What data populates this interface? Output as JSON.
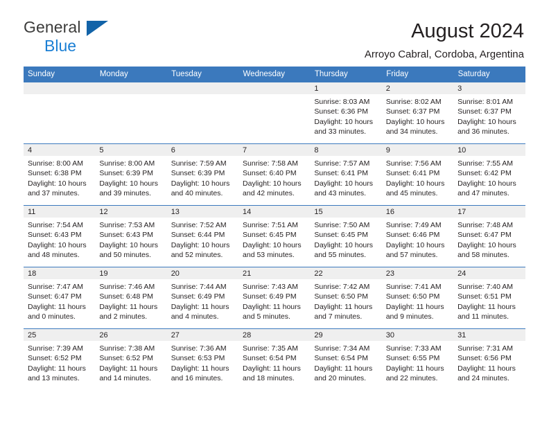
{
  "brand": {
    "line1": "General",
    "line2": "Blue",
    "logo_icon": "triangle-logo-icon"
  },
  "header": {
    "title": "August 2024",
    "subtitle": "Arroyo Cabral, Cordoba, Argentina"
  },
  "colors": {
    "header_blue": "#3b79bd",
    "brand_blue": "#1b7fd4",
    "logo_blue": "#1263a8",
    "band_gray": "#efefef",
    "text": "#231f20"
  },
  "weekdays": [
    "Sunday",
    "Monday",
    "Tuesday",
    "Wednesday",
    "Thursday",
    "Friday",
    "Saturday"
  ],
  "labels": {
    "sunrise": "Sunrise:",
    "sunset": "Sunset:",
    "daylight": "Daylight:"
  },
  "weeks": [
    [
      {
        "day": "",
        "empty": true
      },
      {
        "day": "",
        "empty": true
      },
      {
        "day": "",
        "empty": true
      },
      {
        "day": "",
        "empty": true
      },
      {
        "day": "1",
        "sunrise": "Sunrise: 8:03 AM",
        "sunset": "Sunset: 6:36 PM",
        "daylight_1": "Daylight: 10 hours",
        "daylight_2": "and 33 minutes."
      },
      {
        "day": "2",
        "sunrise": "Sunrise: 8:02 AM",
        "sunset": "Sunset: 6:37 PM",
        "daylight_1": "Daylight: 10 hours",
        "daylight_2": "and 34 minutes."
      },
      {
        "day": "3",
        "sunrise": "Sunrise: 8:01 AM",
        "sunset": "Sunset: 6:37 PM",
        "daylight_1": "Daylight: 10 hours",
        "daylight_2": "and 36 minutes."
      }
    ],
    [
      {
        "day": "4",
        "sunrise": "Sunrise: 8:00 AM",
        "sunset": "Sunset: 6:38 PM",
        "daylight_1": "Daylight: 10 hours",
        "daylight_2": "and 37 minutes."
      },
      {
        "day": "5",
        "sunrise": "Sunrise: 8:00 AM",
        "sunset": "Sunset: 6:39 PM",
        "daylight_1": "Daylight: 10 hours",
        "daylight_2": "and 39 minutes."
      },
      {
        "day": "6",
        "sunrise": "Sunrise: 7:59 AM",
        "sunset": "Sunset: 6:39 PM",
        "daylight_1": "Daylight: 10 hours",
        "daylight_2": "and 40 minutes."
      },
      {
        "day": "7",
        "sunrise": "Sunrise: 7:58 AM",
        "sunset": "Sunset: 6:40 PM",
        "daylight_1": "Daylight: 10 hours",
        "daylight_2": "and 42 minutes."
      },
      {
        "day": "8",
        "sunrise": "Sunrise: 7:57 AM",
        "sunset": "Sunset: 6:41 PM",
        "daylight_1": "Daylight: 10 hours",
        "daylight_2": "and 43 minutes."
      },
      {
        "day": "9",
        "sunrise": "Sunrise: 7:56 AM",
        "sunset": "Sunset: 6:41 PM",
        "daylight_1": "Daylight: 10 hours",
        "daylight_2": "and 45 minutes."
      },
      {
        "day": "10",
        "sunrise": "Sunrise: 7:55 AM",
        "sunset": "Sunset: 6:42 PM",
        "daylight_1": "Daylight: 10 hours",
        "daylight_2": "and 47 minutes."
      }
    ],
    [
      {
        "day": "11",
        "sunrise": "Sunrise: 7:54 AM",
        "sunset": "Sunset: 6:43 PM",
        "daylight_1": "Daylight: 10 hours",
        "daylight_2": "and 48 minutes."
      },
      {
        "day": "12",
        "sunrise": "Sunrise: 7:53 AM",
        "sunset": "Sunset: 6:43 PM",
        "daylight_1": "Daylight: 10 hours",
        "daylight_2": "and 50 minutes."
      },
      {
        "day": "13",
        "sunrise": "Sunrise: 7:52 AM",
        "sunset": "Sunset: 6:44 PM",
        "daylight_1": "Daylight: 10 hours",
        "daylight_2": "and 52 minutes."
      },
      {
        "day": "14",
        "sunrise": "Sunrise: 7:51 AM",
        "sunset": "Sunset: 6:45 PM",
        "daylight_1": "Daylight: 10 hours",
        "daylight_2": "and 53 minutes."
      },
      {
        "day": "15",
        "sunrise": "Sunrise: 7:50 AM",
        "sunset": "Sunset: 6:45 PM",
        "daylight_1": "Daylight: 10 hours",
        "daylight_2": "and 55 minutes."
      },
      {
        "day": "16",
        "sunrise": "Sunrise: 7:49 AM",
        "sunset": "Sunset: 6:46 PM",
        "daylight_1": "Daylight: 10 hours",
        "daylight_2": "and 57 minutes."
      },
      {
        "day": "17",
        "sunrise": "Sunrise: 7:48 AM",
        "sunset": "Sunset: 6:47 PM",
        "daylight_1": "Daylight: 10 hours",
        "daylight_2": "and 58 minutes."
      }
    ],
    [
      {
        "day": "18",
        "sunrise": "Sunrise: 7:47 AM",
        "sunset": "Sunset: 6:47 PM",
        "daylight_1": "Daylight: 11 hours",
        "daylight_2": "and 0 minutes."
      },
      {
        "day": "19",
        "sunrise": "Sunrise: 7:46 AM",
        "sunset": "Sunset: 6:48 PM",
        "daylight_1": "Daylight: 11 hours",
        "daylight_2": "and 2 minutes."
      },
      {
        "day": "20",
        "sunrise": "Sunrise: 7:44 AM",
        "sunset": "Sunset: 6:49 PM",
        "daylight_1": "Daylight: 11 hours",
        "daylight_2": "and 4 minutes."
      },
      {
        "day": "21",
        "sunrise": "Sunrise: 7:43 AM",
        "sunset": "Sunset: 6:49 PM",
        "daylight_1": "Daylight: 11 hours",
        "daylight_2": "and 5 minutes."
      },
      {
        "day": "22",
        "sunrise": "Sunrise: 7:42 AM",
        "sunset": "Sunset: 6:50 PM",
        "daylight_1": "Daylight: 11 hours",
        "daylight_2": "and 7 minutes."
      },
      {
        "day": "23",
        "sunrise": "Sunrise: 7:41 AM",
        "sunset": "Sunset: 6:50 PM",
        "daylight_1": "Daylight: 11 hours",
        "daylight_2": "and 9 minutes."
      },
      {
        "day": "24",
        "sunrise": "Sunrise: 7:40 AM",
        "sunset": "Sunset: 6:51 PM",
        "daylight_1": "Daylight: 11 hours",
        "daylight_2": "and 11 minutes."
      }
    ],
    [
      {
        "day": "25",
        "sunrise": "Sunrise: 7:39 AM",
        "sunset": "Sunset: 6:52 PM",
        "daylight_1": "Daylight: 11 hours",
        "daylight_2": "and 13 minutes."
      },
      {
        "day": "26",
        "sunrise": "Sunrise: 7:38 AM",
        "sunset": "Sunset: 6:52 PM",
        "daylight_1": "Daylight: 11 hours",
        "daylight_2": "and 14 minutes."
      },
      {
        "day": "27",
        "sunrise": "Sunrise: 7:36 AM",
        "sunset": "Sunset: 6:53 PM",
        "daylight_1": "Daylight: 11 hours",
        "daylight_2": "and 16 minutes."
      },
      {
        "day": "28",
        "sunrise": "Sunrise: 7:35 AM",
        "sunset": "Sunset: 6:54 PM",
        "daylight_1": "Daylight: 11 hours",
        "daylight_2": "and 18 minutes."
      },
      {
        "day": "29",
        "sunrise": "Sunrise: 7:34 AM",
        "sunset": "Sunset: 6:54 PM",
        "daylight_1": "Daylight: 11 hours",
        "daylight_2": "and 20 minutes."
      },
      {
        "day": "30",
        "sunrise": "Sunrise: 7:33 AM",
        "sunset": "Sunset: 6:55 PM",
        "daylight_1": "Daylight: 11 hours",
        "daylight_2": "and 22 minutes."
      },
      {
        "day": "31",
        "sunrise": "Sunrise: 7:31 AM",
        "sunset": "Sunset: 6:56 PM",
        "daylight_1": "Daylight: 11 hours",
        "daylight_2": "and 24 minutes."
      }
    ]
  ]
}
